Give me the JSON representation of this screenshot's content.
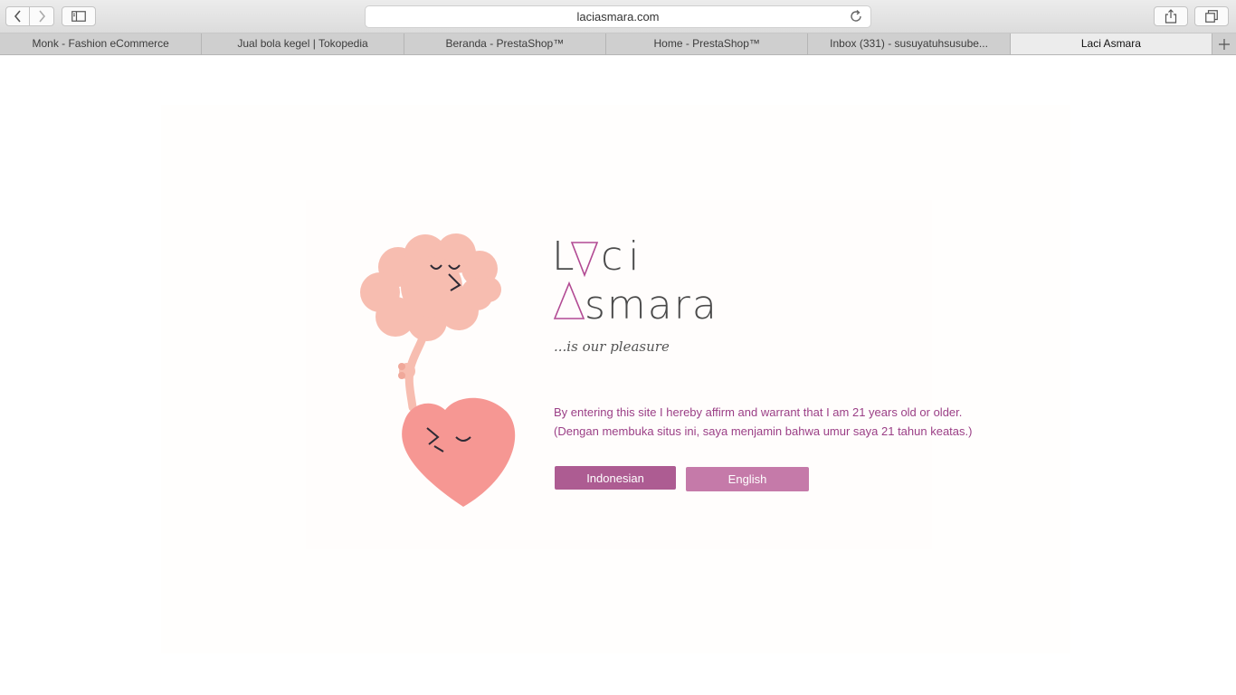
{
  "browser": {
    "url": "laciasmara.com",
    "tabs": [
      {
        "label": "Monk - Fashion eCommerce"
      },
      {
        "label": "Jual bola kegel | Tokopedia"
      },
      {
        "label": "Beranda - PrestaShop™"
      },
      {
        "label": "Home - PrestaShop™"
      },
      {
        "label": "Inbox (331) - susuyatuhsusube..."
      },
      {
        "label": "Laci Asmara",
        "active": true
      }
    ],
    "icons": [
      "back-icon",
      "forward-icon",
      "sidebar-icon",
      "reload-icon",
      "share-icon",
      "tabs-overview-icon",
      "new-tab-icon"
    ]
  },
  "page": {
    "logo": {
      "line1": [
        "L",
        "ci"
      ],
      "line2": [
        "smara"
      ],
      "brand_color": "#b24a93",
      "text_color": "#4a4a4a"
    },
    "tagline": "...is our pleasure",
    "affirmation": [
      "By entering this site I hereby affirm and warrant that I am 21 years old or older.",
      "(Dengan membuka situs ini, saya menjamin bahwa umur saya 21 tahun keatas.)"
    ],
    "buttons": {
      "indonesian": "Indonesian",
      "english": "English"
    },
    "colors": {
      "text_accent": "#9b3f86",
      "button_primary": "#ad5c92",
      "button_secondary": "#c57aa9",
      "brain": "#f7bdb0",
      "heart": "#f69793"
    }
  }
}
